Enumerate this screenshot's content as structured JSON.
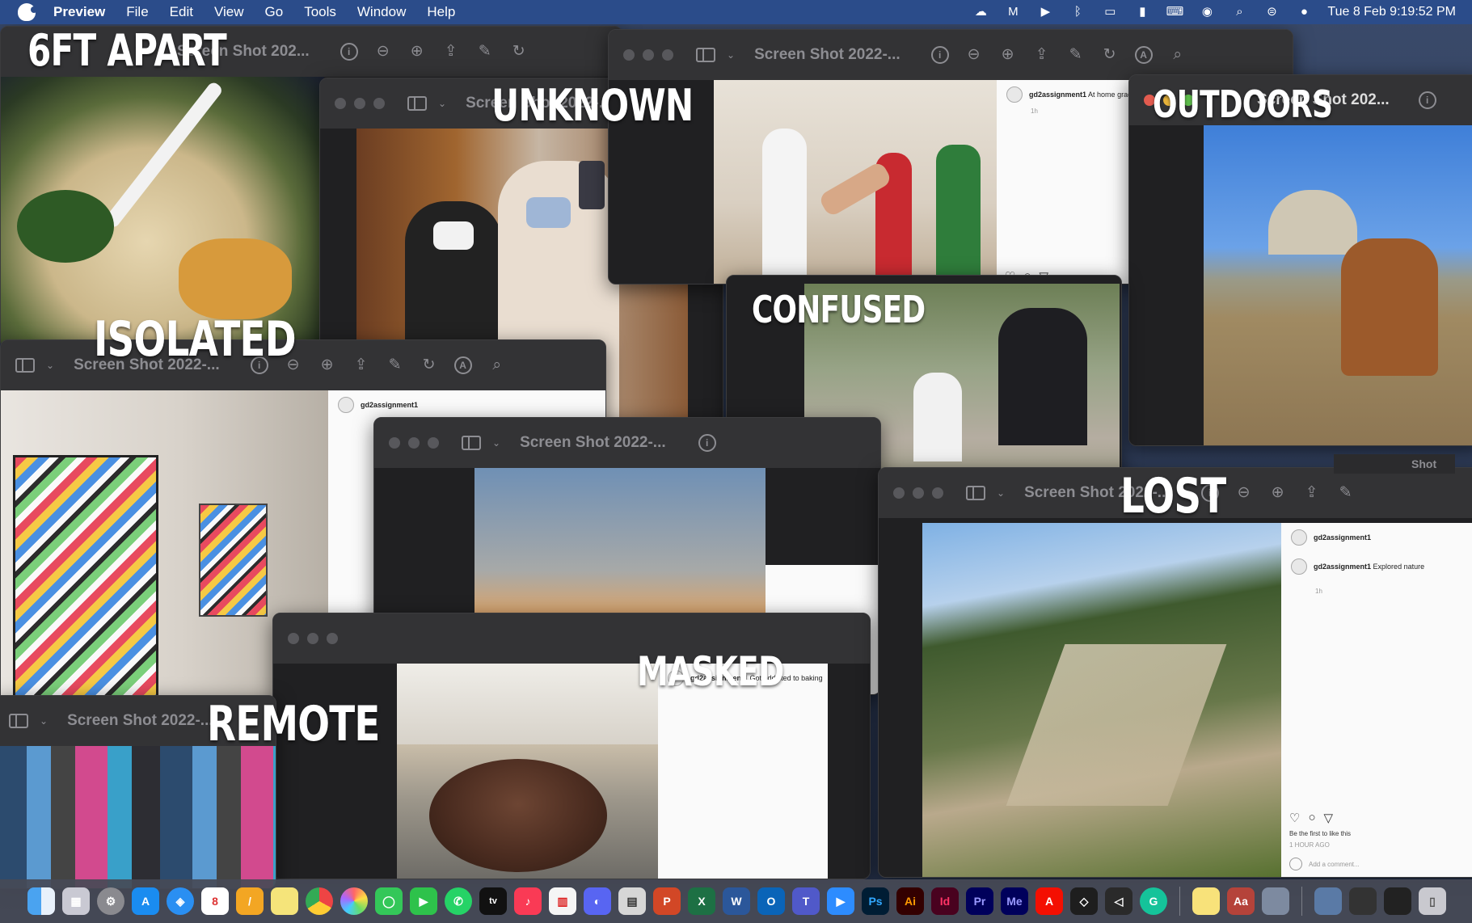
{
  "menubar": {
    "app_name": "Preview",
    "menus": [
      "File",
      "Edit",
      "View",
      "Go",
      "Tools",
      "Window",
      "Help"
    ],
    "clock": "Tue 8 Feb 9:19:52 PM"
  },
  "window_title": "Screen Shot 2022-...",
  "window_title_short": "Screen Shot 202...",
  "labels": {
    "six_ft_apart": "6FT APART",
    "unknown": "UNKNOWN",
    "outdoors": "OUTDOORS",
    "isolated": "ISOLATED",
    "confused": "CONFUSED",
    "lost": "LOST",
    "masked": "MASKED",
    "remote": "REMOTE"
  },
  "instagram": {
    "username": "gd2assignment1",
    "caption_graduation": "At home graduation",
    "caption_nature": "Explored nature",
    "caption_cake": "Got addicted to baking",
    "time_1h": "1h",
    "likes_prompt": "Be the first to like this",
    "time_ago": "1 HOUR AGO",
    "add_comment": "Add a comment..."
  },
  "partial_title": "Shot",
  "colors": {
    "menubar_bg": "#2b4c8a",
    "window_bg": "#2a2a2c",
    "titlebar_bg": "#333335",
    "dock_bg": "#464a56"
  }
}
